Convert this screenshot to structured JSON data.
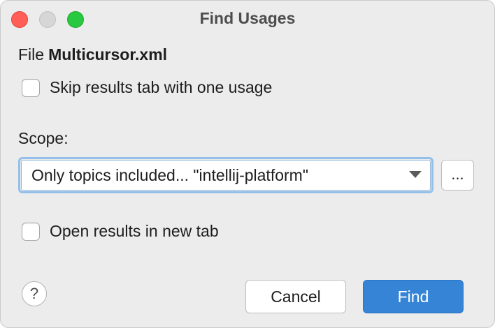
{
  "dialog": {
    "title": "Find Usages"
  },
  "file": {
    "prefix": "File",
    "name": "Multicursor.xml"
  },
  "skip_results_checkbox": {
    "label": "Skip results tab with one usage",
    "checked": false
  },
  "scope": {
    "label": "Scope:",
    "selected_value": "Only topics included... \"intellij-platform\"",
    "browse_label": "..."
  },
  "open_new_tab_checkbox": {
    "label": "Open results in new tab",
    "checked": false
  },
  "footer": {
    "help_label": "?",
    "cancel_label": "Cancel",
    "find_label": "Find"
  },
  "colors": {
    "window_background": "#ececec",
    "primary_button": "#3584d6",
    "focus_ring": "#94bfe9",
    "close_traffic_light": "#ff5f57",
    "minimize_traffic_light": "#d6d6d6",
    "zoom_traffic_light": "#28c840"
  }
}
